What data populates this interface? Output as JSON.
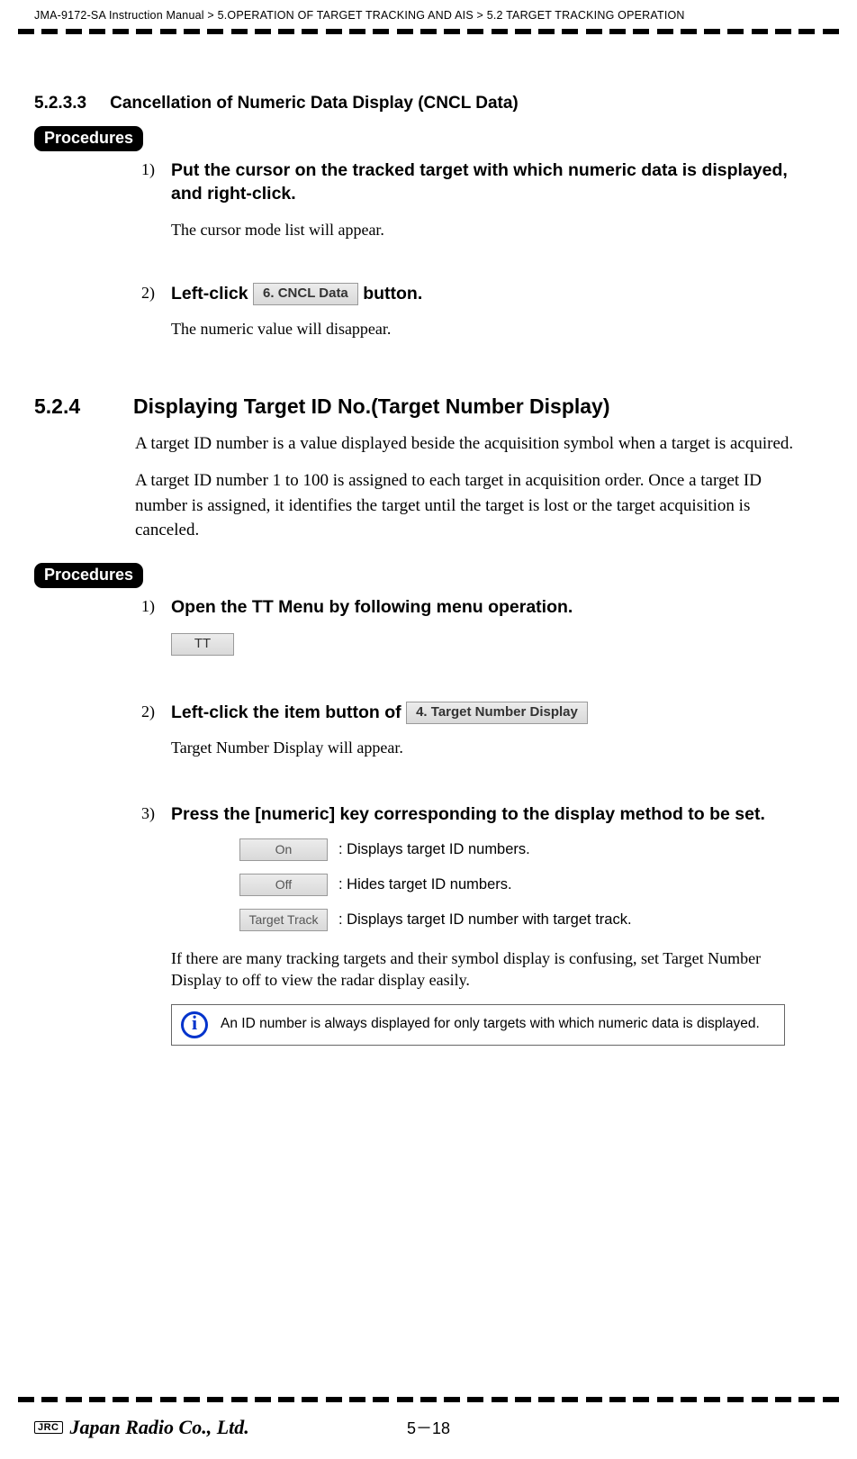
{
  "header": {
    "breadcrumb": "JMA-9172-SA Instruction Manual > 5.OPERATION OF TARGET TRACKING AND AIS > 5.2  TARGET TRACKING OPERATION"
  },
  "section_5_2_3_3": {
    "number": "5.2.3.3",
    "title": "Cancellation of Numeric Data Display (CNCL Data)",
    "procedures_label": "Procedures",
    "step1": {
      "num": "1)",
      "heading": "Put the cursor on the tracked target with which numeric data is displayed, and right-click.",
      "body": "The cursor mode list will appear."
    },
    "step2": {
      "num": "2)",
      "heading_before": "Left-click ",
      "button": "6. CNCL Data",
      "heading_after": " button.",
      "body": "The numeric value will disappear."
    }
  },
  "section_5_2_4": {
    "number": "5.2.4",
    "title": "Displaying Target ID No.(Target Number Display)",
    "para1": "A target ID number is a value displayed beside the acquisition symbol when a target is acquired.",
    "para2": "A target ID number 1 to 100 is assigned to each target in acquisition order. Once a target ID number is assigned, it identifies the target until the target is lost or the target acquisition is canceled.",
    "procedures_label": "Procedures",
    "step1": {
      "num": "1)",
      "heading": "Open the TT Menu by following menu operation.",
      "button": "TT"
    },
    "step2": {
      "num": "2)",
      "heading_before": "Left-click the item button of ",
      "button": "4. Target Number Display",
      "body": "Target Number Display will appear."
    },
    "step3": {
      "num": "3)",
      "heading": "Press the [numeric] key corresponding to the display method to be set.",
      "options": [
        {
          "btn": "On",
          "desc": ": Displays target ID numbers."
        },
        {
          "btn": "Off",
          "desc": ": Hides target ID numbers."
        },
        {
          "btn": "Target Track",
          "desc": ": Displays target ID number with target track."
        }
      ],
      "after": "If there are many tracking targets and their symbol display is confusing, set Target Number Display to off to view the radar display easily.",
      "info": "An ID number is always displayed for only targets with which numeric data is displayed."
    }
  },
  "footer": {
    "jrc": "JRC",
    "brand": "Japan Radio Co., Ltd.",
    "page": "5－18"
  }
}
